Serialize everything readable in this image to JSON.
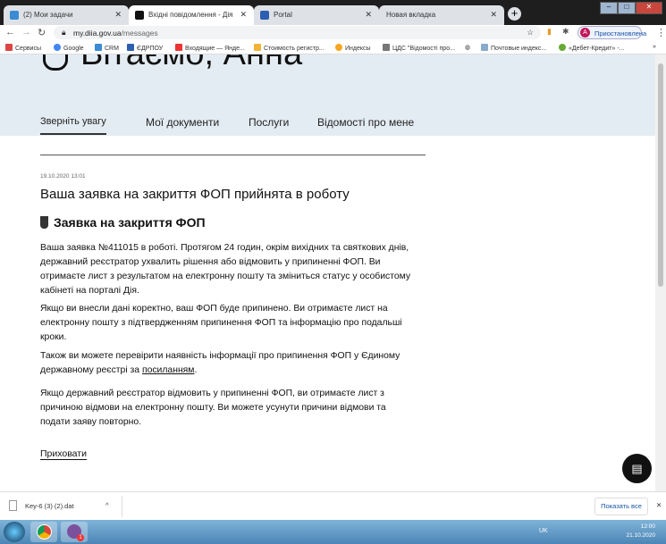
{
  "browser": {
    "tabs": [
      {
        "label": "(2) Мои задачи",
        "active": false,
        "color": "#3a8bd4"
      },
      {
        "label": "Вхідні повідомлення - Дія",
        "active": true,
        "color": "#111111"
      },
      {
        "label": "Portal",
        "active": false,
        "color": "#2d5fb0"
      },
      {
        "label": "Новая вкладка",
        "active": false,
        "color": ""
      }
    ],
    "url_host": "my.diia.gov.ua",
    "url_path": "/messages",
    "profile_initial": "A",
    "profile_label": "Приостановлена",
    "bookmarks": [
      "Сервисы",
      "Google",
      "CRM",
      "ЄДРПОУ",
      "Входящие — Янде...",
      "Стоимость регистр...",
      "Индексы",
      "ЦДС \"Відомості про...",
      "Почтовые индекс...",
      "«Дебет-Кредит» -..."
    ]
  },
  "page": {
    "greeting": "Вітаємо, Анна",
    "nav": [
      "Зверніть увагу",
      "Мої документи",
      "Послуги",
      "Відомості про мене"
    ],
    "message": {
      "date": "19.10.2020 13:01",
      "title": "Ваша заявка на закриття ФОП прийнята в роботу",
      "subtitle": "Заявка на закриття ФОП",
      "p1": "Ваша заявка №411015 в роботі. Протягом 24 годин, окрім вихідних та святкових днів, державний реєстратор ухвалить рішення або відмовить у припиненні ФОП. Ви отримаєте лист з результатом на електронну пошту та зміниться статус у особистому кабінеті на порталі Дія.",
      "p2": "Якщо ви внесли дані коректно, ваш ФОП буде припинено. Ви отримаєте лист на електронну пошту з підтвердженням припинення ФОП та інформацію про подальші кроки.",
      "p3_before": "Також ви можете перевірити наявність інформації про припинення ФОП у Єдиному державному реєстрі за ",
      "p3_link": "посиланням",
      "p3_after": ".",
      "p4": "Якщо державний реєстратор відмовить у припиненні ФОП, ви отримаєте лист з причиною відмови на електронну пошту. Ви можете усунути причини відмови та подати заяву повторно."
    },
    "hide_label": "Приховати"
  },
  "downloads": {
    "file": "Key-6 (3) (2).dat",
    "show_all": "Показать все"
  },
  "taskbar": {
    "lang": "UK",
    "time": "12:00",
    "date": "21.10.2020",
    "viber_badge": "1"
  }
}
